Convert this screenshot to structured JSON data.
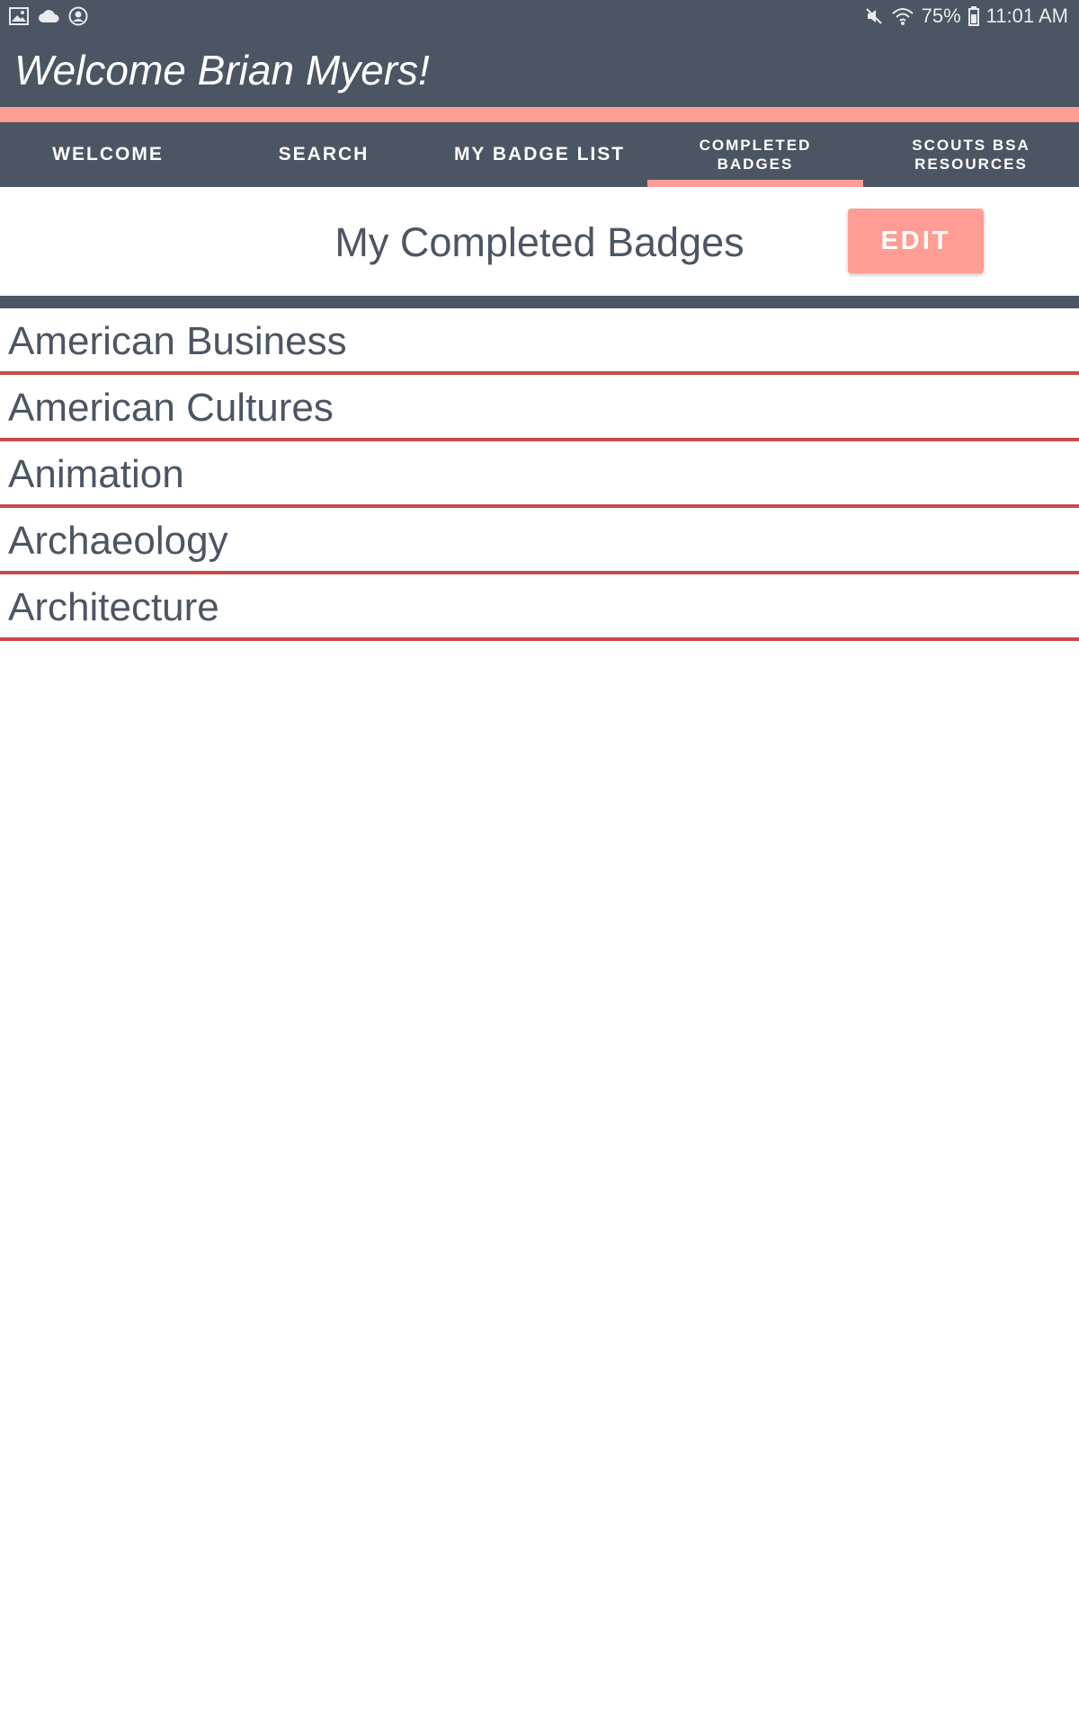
{
  "status_bar": {
    "left_icons": [
      "image-icon",
      "cloud-icon",
      "account-circle-icon"
    ],
    "right_icons": [
      "mute-icon",
      "wifi-icon",
      "battery-icon"
    ],
    "battery": "75%",
    "time": "11:01 AM"
  },
  "header": {
    "title": "Welcome Brian Myers!"
  },
  "tabs": [
    {
      "label": "WELCOME",
      "active": false
    },
    {
      "label": "SEARCH",
      "active": false
    },
    {
      "label": "MY BADGE LIST",
      "active": false
    },
    {
      "label": "COMPLETED BADGES",
      "active": true
    },
    {
      "label": "SCOUTS BSA RESOURCES",
      "active": false
    }
  ],
  "page": {
    "title": "My Completed Badges",
    "edit_label": "EDIT"
  },
  "badges": [
    {
      "label": "American Business"
    },
    {
      "label": "American Cultures"
    },
    {
      "label": "Animation"
    },
    {
      "label": "Archaeology"
    },
    {
      "label": "Architecture"
    }
  ],
  "colors": {
    "primary": "#4c5563",
    "accent": "#ff9d94",
    "divider": "#c84b4b"
  }
}
